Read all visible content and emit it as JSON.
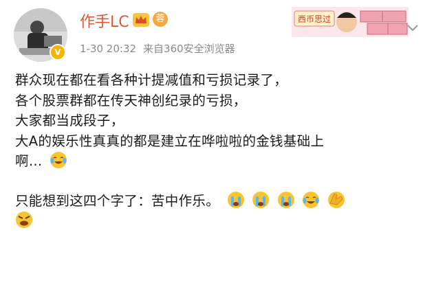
{
  "post": {
    "username": "作手LC",
    "level_badge": "蓉",
    "avatar_badge": "V",
    "date": "1-30 20:32",
    "source": "来自360安全浏览器",
    "sticker_text": "西币思过",
    "lines": [
      "群众现在都在看各种计提减值和亏损记录了，",
      "各个股票群都在传天神创纪录的亏损，",
      "大家都当成段子，",
      "大A的娱乐性真真的都是建立在哗啦啦的金钱基础上",
      "啊…"
    ],
    "final_line": "只能想到这四个字了：苦中作乐。"
  },
  "colors": {
    "username": "#e3552e",
    "meta": "#8a8a8a",
    "emoji": "#f7c531"
  },
  "icons": [
    "crown-icon",
    "level-icon",
    "chevron-down-icon",
    "laugh-cry-emoji",
    "cry-emoji",
    "angry-emoji"
  ]
}
